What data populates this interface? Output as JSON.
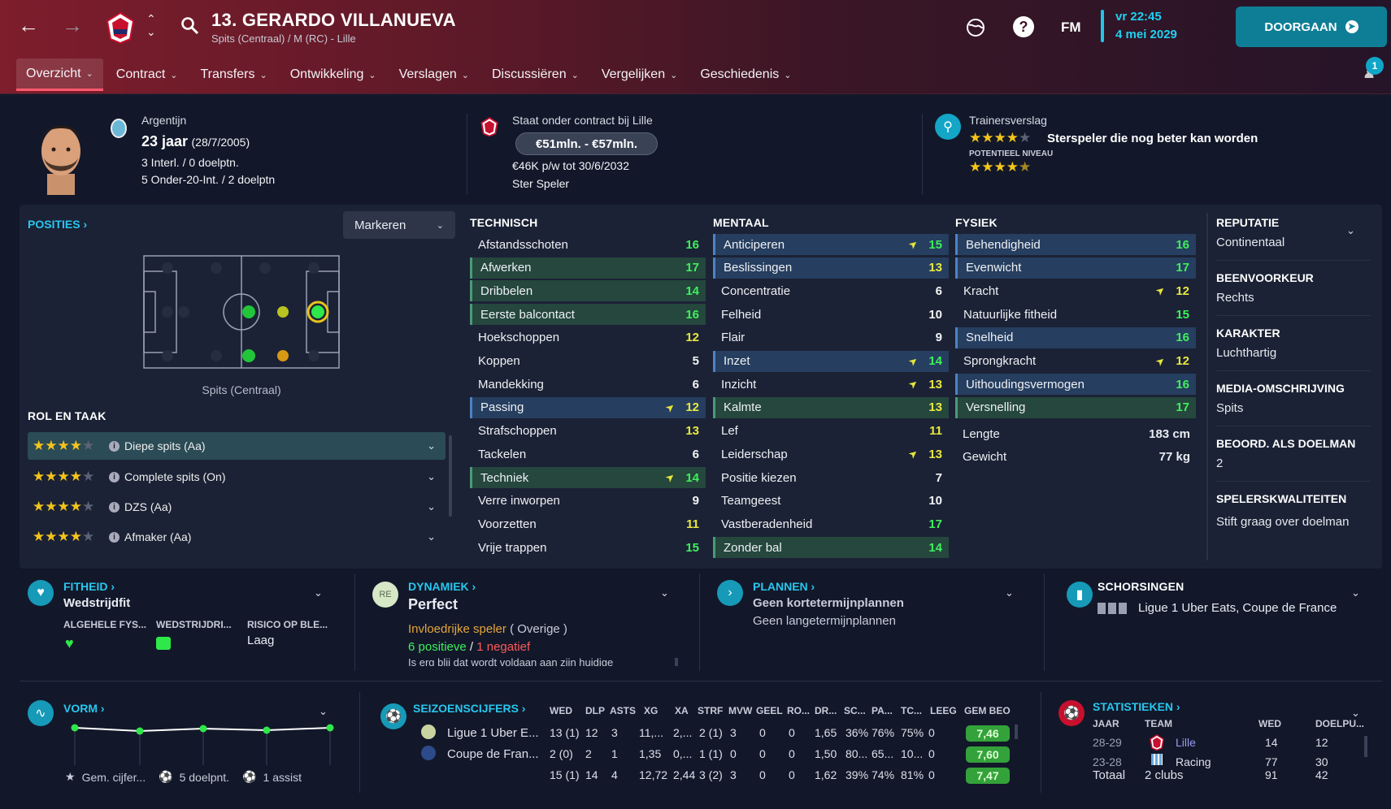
{
  "header": {
    "title": "13. GERARDO VILLANUEVA",
    "subtitle": "Spits (Centraal) / M (RC) - Lille",
    "time": "vr 22:45",
    "date": "4 mei 2029",
    "fm_label": "FM",
    "continue_label": "DOORGAAN",
    "notification_count": "1",
    "nav": [
      "Overzicht",
      "Contract",
      "Transfers",
      "Ontwikkeling",
      "Verslagen",
      "Discussiëren",
      "Vergelijken",
      "Geschiedenis"
    ]
  },
  "profile": {
    "nationality": "Argentijn",
    "age": "23 jaar",
    "dob": "(28/7/2005)",
    "caps": "3 Interl. / 0 doelptn.",
    "youth_caps": "5 Onder-20-Int. / 2 doelptn",
    "contract_heading": "Staat onder contract bij Lille",
    "value": "€51mln. - €57mln.",
    "wage": "€46K p/w tot 30/6/2032",
    "status": "Ster Speler",
    "report_heading": "Trainersverslag",
    "report_text": "Sterspeler die nog beter kan worden",
    "potential_label": "POTENTIEEL NIVEAU",
    "current_stars": 4,
    "potential_stars": 4.5
  },
  "positions": {
    "title": "POSITIES",
    "mark_label": "Markeren",
    "position_caption": "Spits (Centraal)",
    "role_title": "ROL EN TAAK",
    "roles": [
      {
        "label": "Diepe spits (Aa)",
        "stars": 4
      },
      {
        "label": "Complete spits (On)",
        "stars": 4
      },
      {
        "label": "DZS (Aa)",
        "stars": 4
      },
      {
        "label": "Afmaker (Aa)",
        "stars": 4
      }
    ]
  },
  "attributes": {
    "technical_title": "TECHNISCH",
    "mental_title": "MENTAAL",
    "physical_title": "FYSIEK",
    "technical": [
      {
        "name": "Afstandsschoten",
        "value": "16",
        "hl": "",
        "arrow": false
      },
      {
        "name": "Afwerken",
        "value": "17",
        "hl": "green",
        "arrow": false
      },
      {
        "name": "Dribbelen",
        "value": "14",
        "hl": "green",
        "arrow": false
      },
      {
        "name": "Eerste balcontact",
        "value": "16",
        "hl": "green",
        "arrow": false
      },
      {
        "name": "Hoekschoppen",
        "value": "12",
        "hl": "",
        "arrow": false
      },
      {
        "name": "Koppen",
        "value": "5",
        "hl": "",
        "arrow": false
      },
      {
        "name": "Mandekking",
        "value": "6",
        "hl": "",
        "arrow": false
      },
      {
        "name": "Passing",
        "value": "12",
        "hl": "blue",
        "arrow": true
      },
      {
        "name": "Strafschoppen",
        "value": "13",
        "hl": "",
        "arrow": false
      },
      {
        "name": "Tackelen",
        "value": "6",
        "hl": "",
        "arrow": false
      },
      {
        "name": "Techniek",
        "value": "14",
        "hl": "green",
        "arrow": true
      },
      {
        "name": "Verre inworpen",
        "value": "9",
        "hl": "",
        "arrow": false
      },
      {
        "name": "Voorzetten",
        "value": "11",
        "hl": "",
        "arrow": false
      },
      {
        "name": "Vrije trappen",
        "value": "15",
        "hl": "",
        "arrow": false
      }
    ],
    "mental": [
      {
        "name": "Anticiperen",
        "value": "15",
        "hl": "blue",
        "arrow": true
      },
      {
        "name": "Beslissingen",
        "value": "13",
        "hl": "blue",
        "arrow": false
      },
      {
        "name": "Concentratie",
        "value": "6",
        "hl": "",
        "arrow": false
      },
      {
        "name": "Felheid",
        "value": "10",
        "hl": "",
        "arrow": false
      },
      {
        "name": "Flair",
        "value": "9",
        "hl": "",
        "arrow": false
      },
      {
        "name": "Inzet",
        "value": "14",
        "hl": "blue",
        "arrow": true
      },
      {
        "name": "Inzicht",
        "value": "13",
        "hl": "",
        "arrow": true
      },
      {
        "name": "Kalmte",
        "value": "13",
        "hl": "green",
        "arrow": false
      },
      {
        "name": "Lef",
        "value": "11",
        "hl": "",
        "arrow": false
      },
      {
        "name": "Leiderschap",
        "value": "13",
        "hl": "",
        "arrow": true
      },
      {
        "name": "Positie kiezen",
        "value": "7",
        "hl": "",
        "arrow": false
      },
      {
        "name": "Teamgeest",
        "value": "10",
        "hl": "",
        "arrow": false
      },
      {
        "name": "Vastberadenheid",
        "value": "17",
        "hl": "",
        "arrow": false
      },
      {
        "name": "Zonder bal",
        "value": "14",
        "hl": "green",
        "arrow": false
      }
    ],
    "physical": [
      {
        "name": "Behendigheid",
        "value": "16",
        "hl": "blue",
        "arrow": false
      },
      {
        "name": "Evenwicht",
        "value": "17",
        "hl": "blue",
        "arrow": false
      },
      {
        "name": "Kracht",
        "value": "12",
        "hl": "",
        "arrow": true
      },
      {
        "name": "Natuurlijke fitheid",
        "value": "15",
        "hl": "",
        "arrow": false
      },
      {
        "name": "Snelheid",
        "value": "16",
        "hl": "blue",
        "arrow": false
      },
      {
        "name": "Sprongkracht",
        "value": "12",
        "hl": "",
        "arrow": true
      },
      {
        "name": "Uithoudingsvermogen",
        "value": "16",
        "hl": "blue",
        "arrow": false
      },
      {
        "name": "Versnelling",
        "value": "17",
        "hl": "green",
        "arrow": false
      }
    ],
    "length_label": "Lengte",
    "length": "183 cm",
    "weight_label": "Gewicht",
    "weight": "77 kg"
  },
  "side": {
    "reputation_h": "REPUTATIE",
    "reputation": "Continentaal",
    "foot_h": "BEENVOORKEUR",
    "foot": "Rechts",
    "character_h": "KARAKTER",
    "character": "Luchthartig",
    "media_h": "MEDIA-OMSCHRIJVING",
    "media": "Spits",
    "gk_h": "BEOORD. ALS DOELMAN",
    "gk": "2",
    "traits_h": "SPELERSKWALITEITEN",
    "traits": "Stift graag over doelman"
  },
  "fitness": {
    "title": "FITHEID",
    "status": "Wedstrijdfit",
    "col1": "ALGEHELE FYS...",
    "col2": "WEDSTRIJDRI...",
    "col3": "RISICO OP BLE...",
    "risk": "Laag"
  },
  "dynamics": {
    "title": "DYNAMIEK",
    "badge": "RE",
    "status": "Perfect",
    "influence": "Invloedrijke speler",
    "influence_group": "( Overige )",
    "positive": "6 positieve",
    "sep": "/",
    "negative": "1 negatief",
    "note": "Is erg blij dat wordt voldaan aan zijn huidige"
  },
  "plans": {
    "title": "PLANNEN",
    "short": "Geen kortetermijnplannen",
    "long": "Geen langetermijnplannen"
  },
  "suspensions": {
    "title": "SCHORSINGEN",
    "text": "Ligue 1 Uber Eats, Coupe de France"
  },
  "form": {
    "title": "VORM",
    "avg": "Gem. cijfer...",
    "goals": "5 doelpnt.",
    "assists": "1 assist"
  },
  "season": {
    "title": "SEIZOENSCIJFERS",
    "headers": [
      "WED",
      "DLP",
      "ASTS",
      "XG",
      "XA",
      "STRF",
      "MVW",
      "GEEL",
      "RO...",
      "DR...",
      "SC...",
      "PA...",
      "TC...",
      "LEEG",
      "GEM BEO"
    ],
    "rows": [
      {
        "comp": "Ligue 1 Uber E...",
        "cells": [
          "13 (1)",
          "12",
          "3",
          "11,...",
          "2,...",
          "2 (1)",
          "3",
          "0",
          "0",
          "1,65",
          "36%",
          "76%",
          "75%",
          "0"
        ],
        "rating": "7,46"
      },
      {
        "comp": "Coupe de Fran...",
        "cells": [
          "2 (0)",
          "2",
          "1",
          "1,35",
          "0,...",
          "1 (1)",
          "0",
          "0",
          "0",
          "1,50",
          "80...",
          "65...",
          "10...",
          "0"
        ],
        "rating": "7,60"
      },
      {
        "comp": "",
        "cells": [
          "15 (1)",
          "14",
          "4",
          "12,72",
          "2,44",
          "3 (2)",
          "3",
          "0",
          "0",
          "1,62",
          "39%",
          "74%",
          "81%",
          "0"
        ],
        "rating": "7,47"
      }
    ]
  },
  "stats": {
    "title": "STATISTIEKEN",
    "headers": [
      "JAAR",
      "TEAM",
      "WED",
      "DOELPU..."
    ],
    "rows": [
      {
        "year": "28-29",
        "team": "Lille",
        "games": "14",
        "goals": "12"
      },
      {
        "year": "23-28",
        "team": "Racing",
        "games": "77",
        "goals": "30"
      }
    ],
    "total_label": "Totaal",
    "total_team": "2 clubs",
    "total_games": "91",
    "total_goals": "42"
  },
  "colors": {
    "accent": "#29c6ee",
    "high": "#3ff05c",
    "mid": "#e8e840",
    "rating": "#34a23a"
  }
}
